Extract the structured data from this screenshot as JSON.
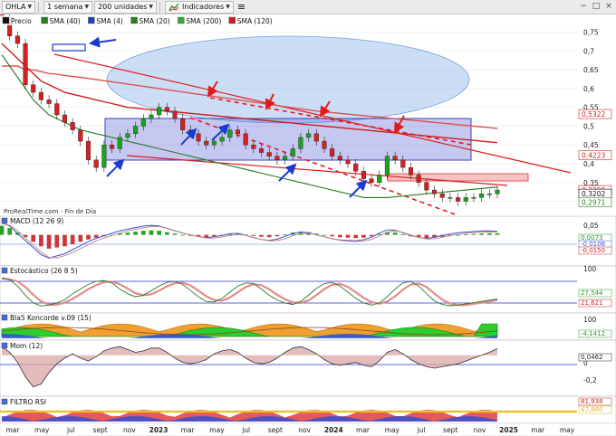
{
  "toolbar": {
    "symbol": "OHLA",
    "period": "1 semana",
    "units": "200 unidades",
    "indicators": "Indicadores",
    "menu_glyph": "≡",
    "win_min": "−",
    "win_max": "□",
    "win_close": "×"
  },
  "main_legend": [
    {
      "label": "Precio",
      "color": "#111111"
    },
    {
      "label": "SMA (40)",
      "color": "#2a7a1e"
    },
    {
      "label": "SMA (4)",
      "color": "#1f3fbf"
    },
    {
      "label": "SMA (20)",
      "color": "#2f7f1f"
    },
    {
      "label": "SMA (200)",
      "color": "#33aa33"
    },
    {
      "label": "SMA (120)",
      "color": "#d01e1e"
    }
  ],
  "source_label": "ProRealTime.com - Fin de Día",
  "colors": {
    "up": "#1aa41a",
    "down": "#d42020",
    "trend": "#e01c1c",
    "blue_box": "#5863d8",
    "ellipse": "#8fb6ea",
    "arrow_blue": "#1b3ad1",
    "arrow_red": "#e01c1c"
  },
  "chart_data": [
    {
      "id": "price",
      "type": "line",
      "name": "OHLA",
      "y_axis": {
        "ticks": [
          0.75,
          0.7,
          0.65,
          0.6,
          0.55,
          0.5,
          0.45,
          0.4,
          0.35,
          0.3
        ],
        "ylim": [
          0.27,
          0.79
        ]
      },
      "x_labels": [
        "mar",
        "may",
        "jul",
        "sept",
        "nov",
        "2023",
        "mar",
        "may",
        "jul",
        "sept",
        "nov",
        "2024",
        "mar",
        "may",
        "jul",
        "sept",
        "nov",
        "2025",
        "mar",
        "may"
      ],
      "close": [
        0.79,
        0.74,
        0.72,
        0.61,
        0.59,
        0.57,
        0.56,
        0.53,
        0.51,
        0.49,
        0.46,
        0.41,
        0.39,
        0.45,
        0.44,
        0.47,
        0.48,
        0.5,
        0.52,
        0.53,
        0.55,
        0.54,
        0.52,
        0.49,
        0.48,
        0.46,
        0.45,
        0.46,
        0.47,
        0.49,
        0.48,
        0.45,
        0.44,
        0.43,
        0.42,
        0.41,
        0.42,
        0.44,
        0.47,
        0.48,
        0.46,
        0.44,
        0.42,
        0.41,
        0.4,
        0.38,
        0.36,
        0.35,
        0.37,
        0.42,
        0.41,
        0.39,
        0.37,
        0.35,
        0.33,
        0.32,
        0.31,
        0.31,
        0.3,
        0.31,
        0.31,
        0.32,
        0.32,
        0.33
      ],
      "sma_slow": [
        0.69,
        0.66,
        0.63,
        0.6,
        0.57,
        0.55,
        0.53,
        0.52,
        0.51,
        0.5,
        0.49,
        0.485,
        0.48,
        0.475,
        0.47,
        0.465,
        0.46,
        0.455,
        0.45,
        0.445,
        0.44,
        0.435,
        0.43,
        0.425,
        0.42,
        0.415,
        0.41,
        0.405,
        0.4,
        0.395,
        0.39,
        0.385,
        0.38,
        0.375,
        0.37,
        0.365,
        0.36,
        0.355,
        0.35,
        0.345,
        0.34,
        0.335,
        0.33,
        0.325,
        0.32,
        0.315,
        0.31,
        0.31,
        0.31,
        0.31,
        0.312,
        0.314,
        0.316,
        0.318,
        0.32,
        0.322,
        0.324,
        0.326,
        0.328,
        0.33,
        0.332,
        0.334,
        0.336,
        0.338
      ],
      "sma_120": [
        0.72,
        0.7,
        0.68,
        0.66,
        0.64,
        0.62,
        0.61,
        0.6,
        0.59,
        0.585,
        0.58,
        0.575,
        0.57,
        0.565,
        0.56,
        0.555,
        0.55,
        0.548,
        0.546,
        0.544,
        0.542,
        0.54,
        0.538,
        0.536,
        0.534,
        0.532,
        0.53,
        0.528,
        0.526,
        0.524,
        0.522,
        0.52,
        0.518,
        0.516,
        0.514,
        0.512,
        0.51,
        0.508,
        0.506,
        0.504,
        0.502,
        0.5,
        0.498,
        0.496,
        0.494,
        0.492,
        0.49,
        0.488,
        0.486,
        0.484,
        0.482,
        0.48,
        0.478,
        0.476,
        0.474,
        0.472,
        0.47,
        0.468,
        0.466,
        0.464,
        0.462,
        0.46,
        0.458,
        0.456
      ],
      "sma_200": [
        0.66,
        0.66,
        0.66,
        0.65,
        0.65,
        0.645,
        0.64,
        0.638,
        0.635,
        0.632,
        0.63,
        0.627,
        0.624,
        0.621,
        0.618,
        0.615,
        0.612,
        0.609,
        0.606,
        0.603,
        0.6,
        0.597,
        0.594,
        0.591,
        0.588,
        0.585,
        0.582,
        0.579,
        0.576,
        0.573,
        0.57,
        0.567,
        0.564,
        0.561,
        0.558,
        0.555,
        0.552,
        0.549,
        0.546,
        0.543,
        0.54,
        0.538,
        0.536,
        0.534,
        0.532,
        0.53,
        0.528,
        0.526,
        0.524,
        0.522,
        0.52,
        0.518,
        0.516,
        0.514,
        0.512,
        0.51,
        0.508,
        0.506,
        0.504,
        0.502,
        0.5,
        0.498,
        0.496,
        0.494
      ],
      "price_tags": [
        {
          "value": "0,5322",
          "y": 0.5322,
          "color": "#d01e1e"
        },
        {
          "value": "0,4223",
          "y": 0.4223,
          "color": "#d01e1e"
        },
        {
          "value": "0,3299",
          "y": 0.3299,
          "color": "#d01e1e"
        },
        {
          "value": "0,3202",
          "y": 0.3202,
          "color": "#111111"
        },
        {
          "value": "0,2971",
          "y": 0.2971,
          "color": "#2f7f1f"
        }
      ]
    },
    {
      "id": "macd",
      "type": "bar",
      "name": "MACD (12 26 9)",
      "y_ticks": [
        0.05,
        0
      ],
      "ylim": [
        -0.12,
        0.07
      ],
      "tags": [
        {
          "value": "0,0073",
          "color": "#2a9a2a"
        },
        {
          "value": "-0,0106",
          "color": "#3355cc"
        },
        {
          "value": "-0,0150",
          "color": "#cc2222"
        }
      ],
      "histogram": [
        0.04,
        0.03,
        0.01,
        -0.01,
        -0.03,
        -0.05,
        -0.06,
        -0.055,
        -0.05,
        -0.04,
        -0.03,
        -0.02,
        -0.012,
        -0.006,
        0,
        0.006,
        0.01,
        0.014,
        0.018,
        0.02,
        0.018,
        0.012,
        0.006,
        0,
        -0.004,
        -0.008,
        -0.01,
        -0.006,
        -0.002,
        0.004,
        0.006,
        0.002,
        -0.004,
        -0.008,
        -0.01,
        -0.006,
        0.002,
        0.01,
        0.014,
        0.012,
        0.006,
        0,
        -0.006,
        -0.01,
        -0.012,
        -0.014,
        -0.012,
        -0.006,
        0.004,
        0.012,
        0.01,
        0.002,
        -0.006,
        -0.012,
        -0.016,
        -0.012,
        -0.008,
        -0.004,
        0,
        0.002,
        0.004,
        0.006,
        0.007,
        0.007
      ]
    },
    {
      "id": "stoch",
      "type": "line",
      "name": "Estocástico (26 8 5)",
      "y_ticks": [
        100
      ],
      "ylim": [
        0,
        100
      ],
      "tags": [
        {
          "value": "27,544",
          "color": "#2a9a2a"
        },
        {
          "value": "21,621",
          "color": "#cc2222"
        }
      ],
      "k": [
        95,
        90,
        70,
        40,
        15,
        5,
        8,
        15,
        25,
        45,
        60,
        75,
        85,
        88,
        80,
        60,
        45,
        35,
        40,
        55,
        70,
        82,
        85,
        75,
        55,
        35,
        20,
        18,
        30,
        50,
        70,
        80,
        78,
        60,
        40,
        25,
        15,
        10,
        20,
        40,
        62,
        78,
        82,
        70,
        50,
        30,
        15,
        8,
        15,
        35,
        60,
        80,
        85,
        70,
        45,
        22,
        10,
        6,
        8,
        12,
        16,
        20,
        24,
        28
      ]
    },
    {
      "id": "koncorde",
      "type": "area",
      "name": "Bla5 Koncorde v.09 (15)",
      "y_ticks": [
        100,
        0
      ],
      "ylim": [
        -30,
        120
      ],
      "tags": [
        {
          "value": "-4,1412",
          "color": "#2a9a2a"
        }
      ]
    },
    {
      "id": "momentum",
      "type": "area",
      "name": "Mom (12)",
      "y_ticks": [
        0,
        -0.2
      ],
      "ylim": [
        -0.26,
        0.08
      ],
      "tags": [
        {
          "value": "0,0462",
          "color": "#222222"
        }
      ],
      "values": [
        0.06,
        0.02,
        -0.05,
        -0.15,
        -0.22,
        -0.2,
        -0.12,
        -0.06,
        -0.02,
        0.01,
        -0.02,
        -0.04,
        -0.01,
        0.03,
        0.05,
        0.06,
        0.04,
        0.02,
        0.03,
        0.05,
        0.05,
        0.02,
        -0.02,
        -0.05,
        -0.06,
        -0.05,
        -0.03,
        0.01,
        0.03,
        0.04,
        0.02,
        -0.02,
        -0.05,
        -0.06,
        -0.05,
        -0.02,
        0.02,
        0.05,
        0.06,
        0.04,
        0.01,
        -0.03,
        -0.06,
        -0.07,
        -0.06,
        -0.05,
        -0.07,
        -0.08,
        -0.04,
        0.02,
        0.04,
        0.01,
        -0.03,
        -0.06,
        -0.08,
        -0.09,
        -0.08,
        -0.07,
        -0.06,
        -0.04,
        -0.02,
        0,
        0.02,
        0.046
      ]
    },
    {
      "id": "filtro",
      "type": "area",
      "name": "FILTRO RSI",
      "y_ticks": [],
      "tags": [
        {
          "value": "81,938",
          "color": "#cc2222"
        },
        {
          "value": "47,860",
          "color": "#e0b020"
        }
      ]
    }
  ]
}
